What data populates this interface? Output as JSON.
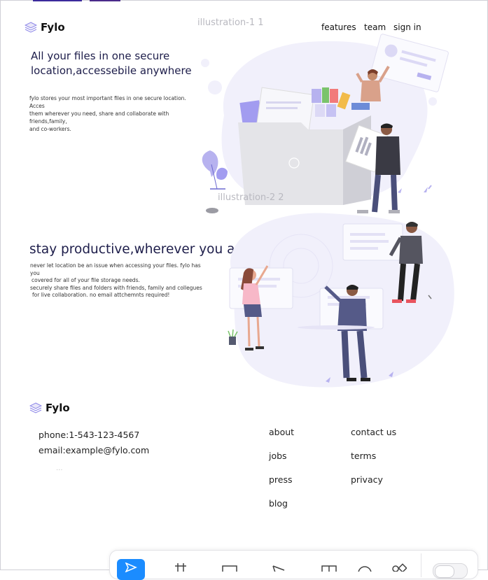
{
  "header": {
    "brand": "Fylo",
    "nav": {
      "features": "features",
      "team": "team",
      "sign_in": "sign in"
    }
  },
  "layers": {
    "illustration_1": "illustration-1 1",
    "illustration_2": "illustration-2 2"
  },
  "hero": {
    "title": "All your files in one secure location,accessebile anywhere",
    "description_lines": [
      "fylo stores your most important files in one secure location. Acces",
      "them wherever you need, share and collaborate with friends,family,",
      "and co-workers."
    ]
  },
  "productivity": {
    "title": "stay productive,wherever you are",
    "description_lines": [
      "never let location be an issue when accessing your files. fylo has you",
      "covered for all of your file storage needs.",
      "securely share files and folders with friends, family and collegues",
      "for live collaboration. no email attchemnts required!"
    ]
  },
  "footer": {
    "brand": "Fylo",
    "phone": "phone:1-543-123-4567",
    "email": "email:example@fylo.com",
    "ellipsis": "...",
    "links_col1": [
      "about",
      "jobs",
      "press",
      "blog"
    ],
    "links_col2": [
      "contact us",
      "terms",
      "privacy"
    ]
  },
  "toolbar": {
    "tools": [
      "move-tool-icon",
      "frame-tool-icon",
      "rectangle-tool-icon",
      "pen-tool-icon",
      "layout-tool-icon",
      "comment-tool-icon",
      "components-tool-icon"
    ],
    "active_tool": "move-tool-icon"
  },
  "colors": {
    "accent": "#1b8cff",
    "heading": "#1d1d4a",
    "blob": "#f1f0fb",
    "illustration_purple": "#8c86e8"
  }
}
